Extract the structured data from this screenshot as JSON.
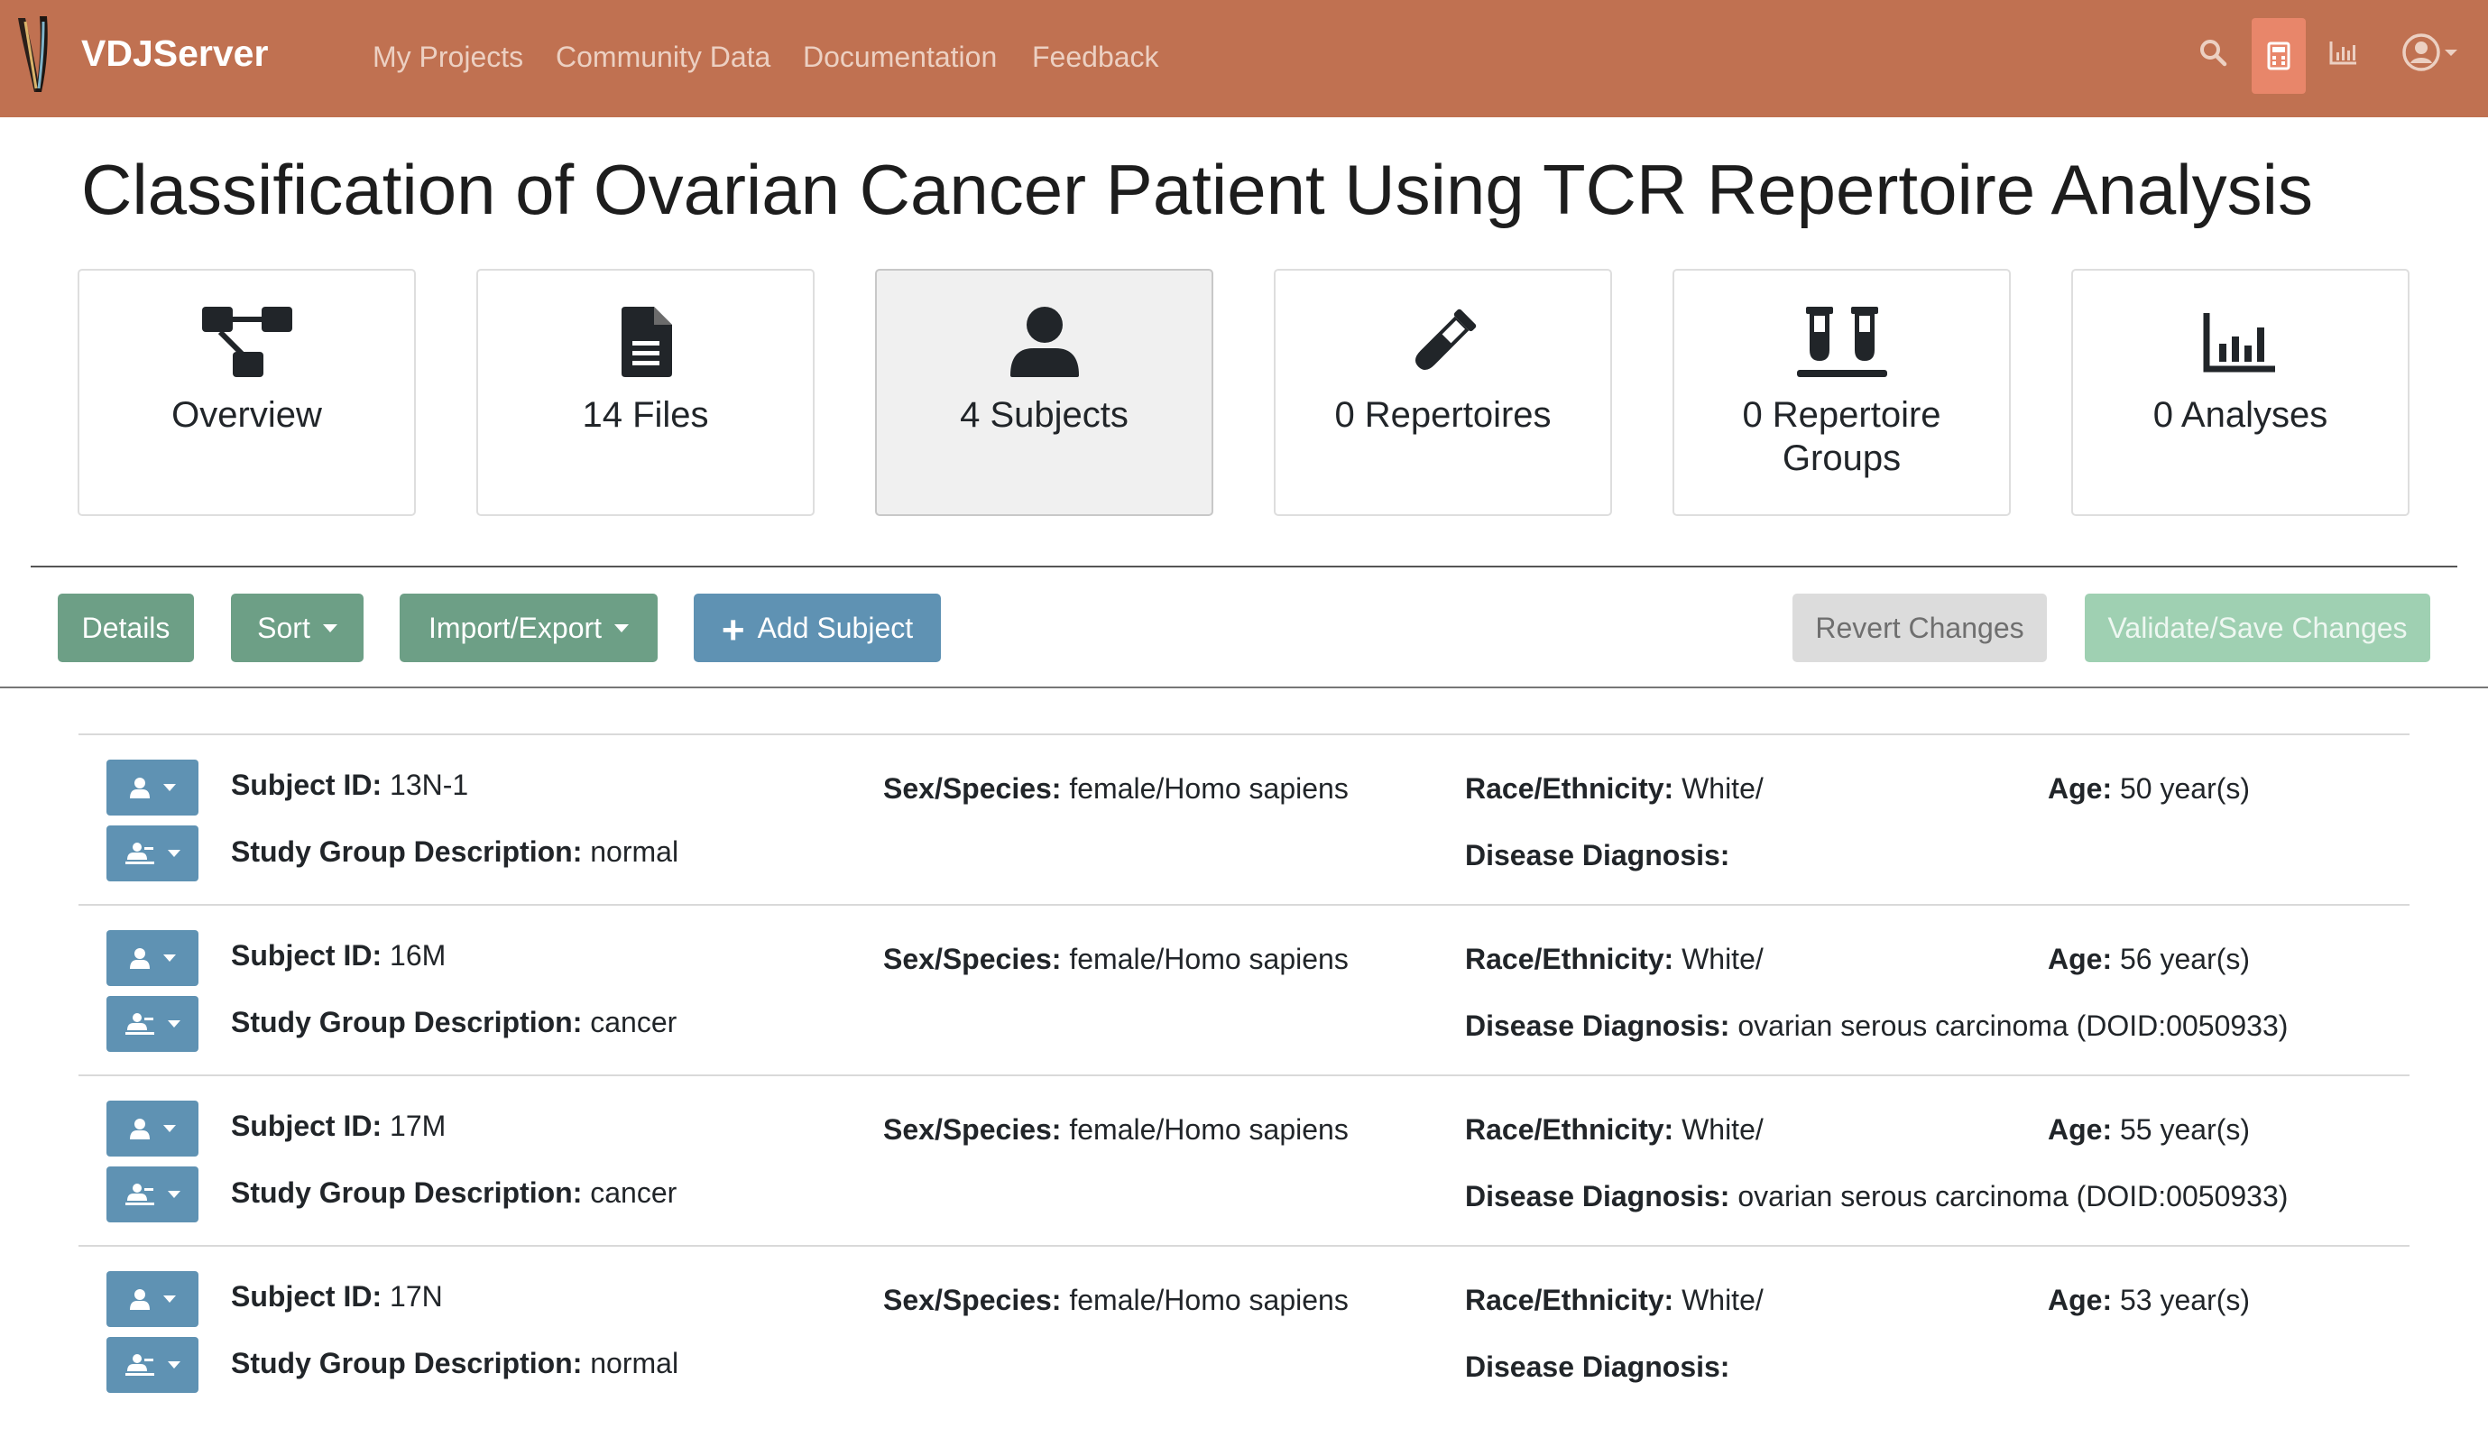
{
  "navbar": {
    "brand": "VDJServer",
    "links": [
      "My Projects",
      "Community Data",
      "Documentation",
      "Feedback"
    ],
    "icons": [
      "search-icon",
      "calculator-icon",
      "chart-icon",
      "user-account-icon"
    ]
  },
  "project": {
    "title": "Classification of Ovarian Cancer Patient Using TCR Repertoire Analysis"
  },
  "tabs": [
    {
      "label": "Overview",
      "icon": "project-tree-icon"
    },
    {
      "label": "14 Files",
      "icon": "file-icon"
    },
    {
      "label": "4 Subjects",
      "icon": "user-icon"
    },
    {
      "label": "0 Repertoires",
      "icon": "vial-icon"
    },
    {
      "label": "0 Repertoire Groups",
      "icon": "vials-icon"
    },
    {
      "label": "0 Analyses",
      "icon": "bar-chart-icon"
    }
  ],
  "toolbar": {
    "details": "Details",
    "sort": "Sort",
    "import_export": "Import/Export",
    "add_subject": "Add Subject",
    "revert": "Revert Changes",
    "validate": "Validate/Save Changes"
  },
  "labels": {
    "subject_id": "Subject ID:",
    "study_group": "Study Group Description:",
    "sex_species": "Sex/Species:",
    "race": "Race/Ethnicity:",
    "disease": "Disease Diagnosis:",
    "age": "Age:"
  },
  "subjects": [
    {
      "id": "13N-1",
      "study_group": "normal",
      "sex_species": "female/Homo sapiens",
      "race": "White/",
      "disease": "",
      "age": "50 year(s)"
    },
    {
      "id": "16M",
      "study_group": "cancer",
      "sex_species": "female/Homo sapiens",
      "race": "White/",
      "disease": "ovarian serous carcinoma (DOID:0050933)",
      "age": "56 year(s)"
    },
    {
      "id": "17M",
      "study_group": "cancer",
      "sex_species": "female/Homo sapiens",
      "race": "White/",
      "disease": "ovarian serous carcinoma (DOID:0050933)",
      "age": "55 year(s)"
    },
    {
      "id": "17N",
      "study_group": "normal",
      "sex_species": "female/Homo sapiens",
      "race": "White/",
      "disease": "",
      "age": "53 year(s)"
    }
  ]
}
